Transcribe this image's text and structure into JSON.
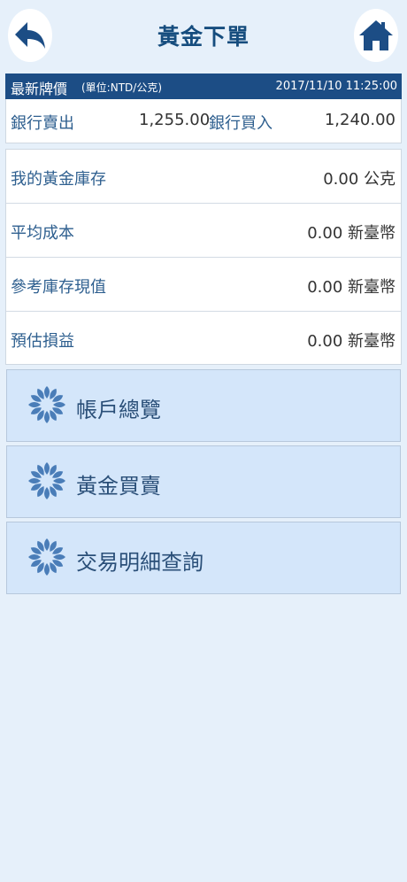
{
  "header": {
    "title": "黃金下單",
    "back_icon": "back-arrow-icon",
    "home_icon": "home-icon"
  },
  "price_board": {
    "title": "最新牌價",
    "unit": "(單位:NTD/公克)",
    "timestamp": "2017/11/10 11:25:00",
    "bank_sell_label": "銀行賣出",
    "bank_sell_value": "1,255.00",
    "bank_buy_label": "銀行買入",
    "bank_buy_value": "1,240.00"
  },
  "holdings": [
    {
      "label": "我的黃金庫存",
      "value": "0.00 公克"
    },
    {
      "label": "平均成本",
      "value": "0.00 新臺幣"
    },
    {
      "label": "參考庫存現值",
      "value": "0.00 新臺幣"
    },
    {
      "label": "預估損益",
      "value": "0.00 新臺幣"
    }
  ],
  "menu": [
    {
      "label": "帳戶總覽",
      "icon": "flower-logo-icon"
    },
    {
      "label": "黃金買賣",
      "icon": "flower-logo-icon"
    },
    {
      "label": "交易明細查詢",
      "icon": "flower-logo-icon"
    }
  ],
  "colors": {
    "background": "#e6f0fa",
    "header_bar": "#1c4d85",
    "label_text": "#2e5f8f",
    "menu_bg": "#d4e6fa"
  }
}
